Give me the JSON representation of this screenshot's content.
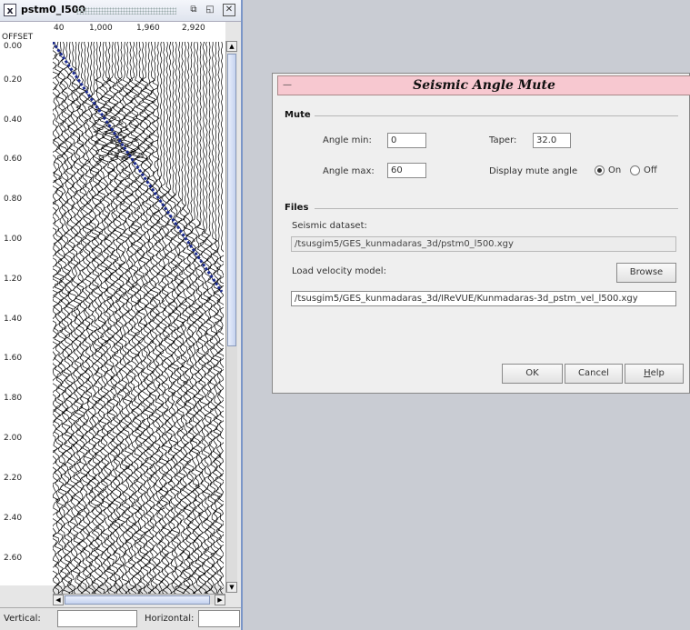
{
  "viewer": {
    "title": "pstm0_l500",
    "offset_label": "OFFSET",
    "x_ticks": [
      "40",
      "1,000",
      "1,960",
      "2,920"
    ],
    "y_ticks": [
      "0.00",
      "0.20",
      "0.40",
      "0.60",
      "0.80",
      "1.00",
      "1.20",
      "1.40",
      "1.60",
      "1.80",
      "2.00",
      "2.20",
      "2.40",
      "2.60"
    ],
    "status": {
      "vertical_label": "Vertical:",
      "vertical_value": "",
      "horizontal_label": "Horizontal:",
      "horizontal_value": ""
    },
    "mute_line_color": "#1b2a8f",
    "trace_color": "#000000"
  },
  "dialog": {
    "title": "Seismic Angle Mute",
    "mute": {
      "section_label": "Mute",
      "angle_min_label": "Angle min:",
      "angle_min_value": "0",
      "angle_max_label": "Angle max:",
      "angle_max_value": "60",
      "taper_label": "Taper:",
      "taper_value": "32.0",
      "display_label": "Display mute angle",
      "on_label": "On",
      "off_label": "Off",
      "selected": "On"
    },
    "files": {
      "section_label": "Files",
      "seismic_label": "Seismic dataset:",
      "seismic_value": "/tsusgim5/GES_kunmadaras_3d/pstm0_l500.xgy",
      "velocity_label": "Load velocity model:",
      "browse_label": "Browse",
      "velocity_value": "/tsusgim5/GES_kunmadaras_3d/IReVUE/Kunmadaras-3d_pstm_vel_l500.xgy"
    },
    "buttons": {
      "ok": "OK",
      "cancel": "Cancel",
      "help_prefix": "H",
      "help_rest": "elp"
    },
    "title_bg": "#f7c8d0"
  }
}
